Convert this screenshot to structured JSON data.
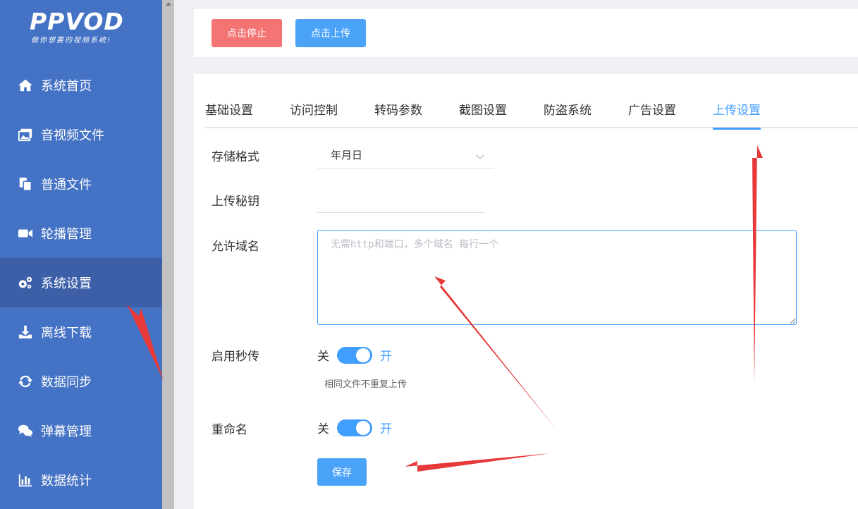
{
  "logo": {
    "main": "PPVOD",
    "slogan": "做你想要的视频系统!"
  },
  "sidebar": {
    "items": [
      {
        "label": "系统首页",
        "icon": "home-icon"
      },
      {
        "label": "音视频文件",
        "icon": "media-files-icon"
      },
      {
        "label": "普通文件",
        "icon": "files-icon"
      },
      {
        "label": "轮播管理",
        "icon": "video-camera-icon"
      },
      {
        "label": "系统设置",
        "icon": "gears-icon",
        "active": true
      },
      {
        "label": "离线下载",
        "icon": "download-icon"
      },
      {
        "label": "数据同步",
        "icon": "sync-icon"
      },
      {
        "label": "弹幕管理",
        "icon": "chat-bubbles-icon"
      },
      {
        "label": "数据统计",
        "icon": "bar-chart-icon"
      }
    ]
  },
  "toolbar": {
    "stop_label": "点击停止",
    "upload_label": "点击上传"
  },
  "tabs": [
    {
      "label": "基础设置"
    },
    {
      "label": "访问控制"
    },
    {
      "label": "转码参数"
    },
    {
      "label": "截图设置"
    },
    {
      "label": "防盗系统"
    },
    {
      "label": "广告设置"
    },
    {
      "label": "上传设置",
      "active": true
    }
  ],
  "form": {
    "storage_format": {
      "label": "存储格式",
      "value": "年月日"
    },
    "upload_key": {
      "label": "上传秘钥",
      "value": ""
    },
    "allowed_domains": {
      "label": "允许域名",
      "placeholder": "无需http和端口，多个域名 每行一个",
      "value": ""
    },
    "instant_upload": {
      "label": "启用秒传",
      "off_label": "关",
      "on_label": "开",
      "enabled": true,
      "hint": "相同文件不重复上传"
    },
    "rename": {
      "label": "重命名",
      "off_label": "关",
      "on_label": "开",
      "enabled": true
    },
    "save_label": "保存"
  },
  "colors": {
    "sidebar": "#4472c4",
    "sidebar_active": "#3c5fa8",
    "primary": "#409eff",
    "danger": "#f47373",
    "annotation_arrow": "#e8393a"
  }
}
